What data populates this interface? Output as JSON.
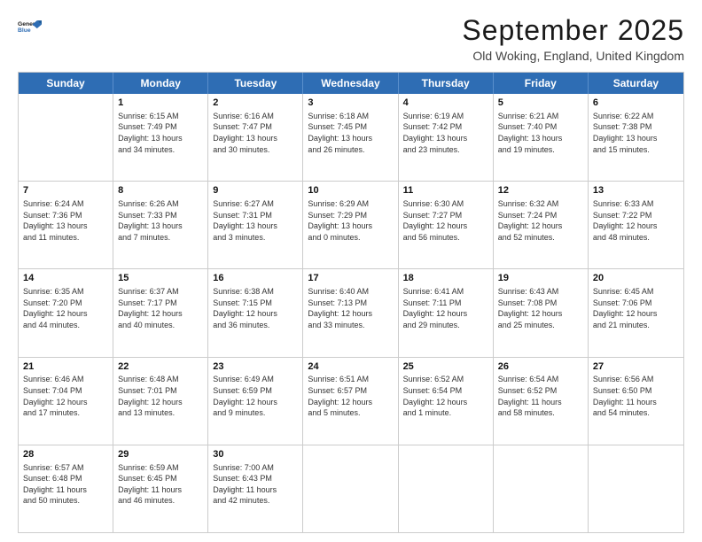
{
  "logo": {
    "line1": "General",
    "line2": "Blue"
  },
  "title": "September 2025",
  "subtitle": "Old Woking, England, United Kingdom",
  "days_of_week": [
    "Sunday",
    "Monday",
    "Tuesday",
    "Wednesday",
    "Thursday",
    "Friday",
    "Saturday"
  ],
  "weeks": [
    [
      {
        "day": "",
        "info": ""
      },
      {
        "day": "1",
        "info": "Sunrise: 6:15 AM\nSunset: 7:49 PM\nDaylight: 13 hours\nand 34 minutes."
      },
      {
        "day": "2",
        "info": "Sunrise: 6:16 AM\nSunset: 7:47 PM\nDaylight: 13 hours\nand 30 minutes."
      },
      {
        "day": "3",
        "info": "Sunrise: 6:18 AM\nSunset: 7:45 PM\nDaylight: 13 hours\nand 26 minutes."
      },
      {
        "day": "4",
        "info": "Sunrise: 6:19 AM\nSunset: 7:42 PM\nDaylight: 13 hours\nand 23 minutes."
      },
      {
        "day": "5",
        "info": "Sunrise: 6:21 AM\nSunset: 7:40 PM\nDaylight: 13 hours\nand 19 minutes."
      },
      {
        "day": "6",
        "info": "Sunrise: 6:22 AM\nSunset: 7:38 PM\nDaylight: 13 hours\nand 15 minutes."
      }
    ],
    [
      {
        "day": "7",
        "info": "Sunrise: 6:24 AM\nSunset: 7:36 PM\nDaylight: 13 hours\nand 11 minutes."
      },
      {
        "day": "8",
        "info": "Sunrise: 6:26 AM\nSunset: 7:33 PM\nDaylight: 13 hours\nand 7 minutes."
      },
      {
        "day": "9",
        "info": "Sunrise: 6:27 AM\nSunset: 7:31 PM\nDaylight: 13 hours\nand 3 minutes."
      },
      {
        "day": "10",
        "info": "Sunrise: 6:29 AM\nSunset: 7:29 PM\nDaylight: 13 hours\nand 0 minutes."
      },
      {
        "day": "11",
        "info": "Sunrise: 6:30 AM\nSunset: 7:27 PM\nDaylight: 12 hours\nand 56 minutes."
      },
      {
        "day": "12",
        "info": "Sunrise: 6:32 AM\nSunset: 7:24 PM\nDaylight: 12 hours\nand 52 minutes."
      },
      {
        "day": "13",
        "info": "Sunrise: 6:33 AM\nSunset: 7:22 PM\nDaylight: 12 hours\nand 48 minutes."
      }
    ],
    [
      {
        "day": "14",
        "info": "Sunrise: 6:35 AM\nSunset: 7:20 PM\nDaylight: 12 hours\nand 44 minutes."
      },
      {
        "day": "15",
        "info": "Sunrise: 6:37 AM\nSunset: 7:17 PM\nDaylight: 12 hours\nand 40 minutes."
      },
      {
        "day": "16",
        "info": "Sunrise: 6:38 AM\nSunset: 7:15 PM\nDaylight: 12 hours\nand 36 minutes."
      },
      {
        "day": "17",
        "info": "Sunrise: 6:40 AM\nSunset: 7:13 PM\nDaylight: 12 hours\nand 33 minutes."
      },
      {
        "day": "18",
        "info": "Sunrise: 6:41 AM\nSunset: 7:11 PM\nDaylight: 12 hours\nand 29 minutes."
      },
      {
        "day": "19",
        "info": "Sunrise: 6:43 AM\nSunset: 7:08 PM\nDaylight: 12 hours\nand 25 minutes."
      },
      {
        "day": "20",
        "info": "Sunrise: 6:45 AM\nSunset: 7:06 PM\nDaylight: 12 hours\nand 21 minutes."
      }
    ],
    [
      {
        "day": "21",
        "info": "Sunrise: 6:46 AM\nSunset: 7:04 PM\nDaylight: 12 hours\nand 17 minutes."
      },
      {
        "day": "22",
        "info": "Sunrise: 6:48 AM\nSunset: 7:01 PM\nDaylight: 12 hours\nand 13 minutes."
      },
      {
        "day": "23",
        "info": "Sunrise: 6:49 AM\nSunset: 6:59 PM\nDaylight: 12 hours\nand 9 minutes."
      },
      {
        "day": "24",
        "info": "Sunrise: 6:51 AM\nSunset: 6:57 PM\nDaylight: 12 hours\nand 5 minutes."
      },
      {
        "day": "25",
        "info": "Sunrise: 6:52 AM\nSunset: 6:54 PM\nDaylight: 12 hours\nand 1 minute."
      },
      {
        "day": "26",
        "info": "Sunrise: 6:54 AM\nSunset: 6:52 PM\nDaylight: 11 hours\nand 58 minutes."
      },
      {
        "day": "27",
        "info": "Sunrise: 6:56 AM\nSunset: 6:50 PM\nDaylight: 11 hours\nand 54 minutes."
      }
    ],
    [
      {
        "day": "28",
        "info": "Sunrise: 6:57 AM\nSunset: 6:48 PM\nDaylight: 11 hours\nand 50 minutes."
      },
      {
        "day": "29",
        "info": "Sunrise: 6:59 AM\nSunset: 6:45 PM\nDaylight: 11 hours\nand 46 minutes."
      },
      {
        "day": "30",
        "info": "Sunrise: 7:00 AM\nSunset: 6:43 PM\nDaylight: 11 hours\nand 42 minutes."
      },
      {
        "day": "",
        "info": ""
      },
      {
        "day": "",
        "info": ""
      },
      {
        "day": "",
        "info": ""
      },
      {
        "day": "",
        "info": ""
      }
    ]
  ]
}
